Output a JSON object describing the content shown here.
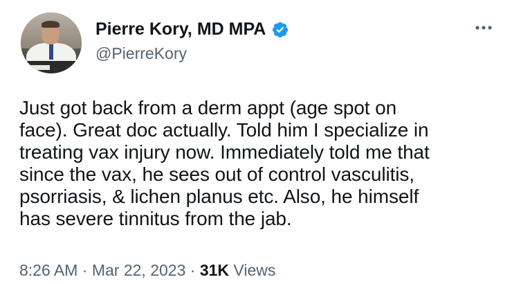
{
  "author": {
    "display_name": "Pierre Kory, MD MPA",
    "handle": "@PierreKory",
    "verified": true
  },
  "tweet": {
    "text_lines": [
      "Just got back from a derm appt (age spot on",
      "face). Great doc actually. Told him I specialize in",
      "treating vax injury now. Immediately told me that",
      "since the vax, he sees out of control vasculitis,",
      "psorriasis, & lichen planus etc. Also, he himself",
      "has severe tinnitus from the jab."
    ]
  },
  "meta": {
    "time": "8:26 AM",
    "separator": "·",
    "date": "Mar 22, 2023",
    "views_count": "31K",
    "views_label": "Views"
  },
  "icons": {
    "verified": "verified-badge-icon",
    "more": "more-options-icon"
  },
  "colors": {
    "text": "#0f1419",
    "secondary": "#536471",
    "verified_blue": "#1d9bf0"
  }
}
